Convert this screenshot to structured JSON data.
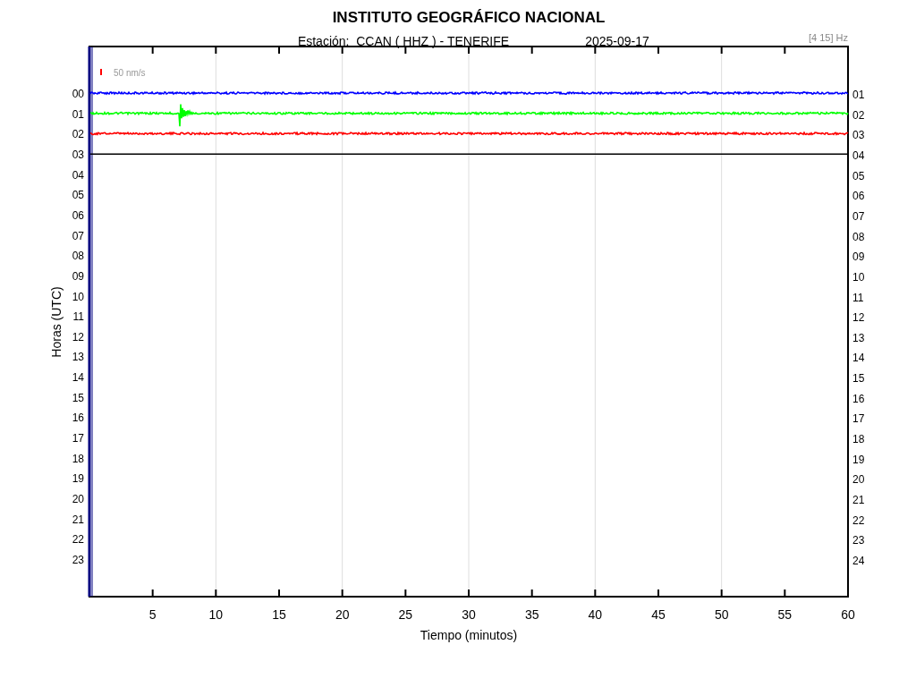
{
  "title": "INSTITUTO GEOGRÁFICO NACIONAL",
  "station": "Estación:  CCAN ( HHZ ) - TENERIFE",
  "date": "2025-09-17",
  "filter": "[4 15] Hz",
  "scale_label": "50 nm/s",
  "ylabel": "Horas (UTC)",
  "xlabel": "Tiempo (minutos)",
  "left_hours": [
    "00",
    "01",
    "02",
    "03",
    "04",
    "05",
    "06",
    "07",
    "08",
    "09",
    "10",
    "11",
    "12",
    "13",
    "14",
    "15",
    "16",
    "17",
    "18",
    "19",
    "20",
    "21",
    "22",
    "23"
  ],
  "right_hours": [
    "01",
    "02",
    "03",
    "04",
    "05",
    "06",
    "07",
    "08",
    "09",
    "10",
    "11",
    "12",
    "13",
    "14",
    "15",
    "16",
    "17",
    "18",
    "19",
    "20",
    "21",
    "22",
    "23",
    "24"
  ],
  "xticks": [
    "5",
    "10",
    "15",
    "20",
    "25",
    "30",
    "35",
    "40",
    "45",
    "50",
    "55",
    "60"
  ],
  "traces": [
    {
      "kind": "waveform",
      "color": "#0000ff"
    },
    {
      "kind": "waveform",
      "color": "#00ff00"
    },
    {
      "kind": "waveform",
      "color": "#ff0000"
    },
    {
      "kind": "flat",
      "color": "#000000"
    }
  ]
}
